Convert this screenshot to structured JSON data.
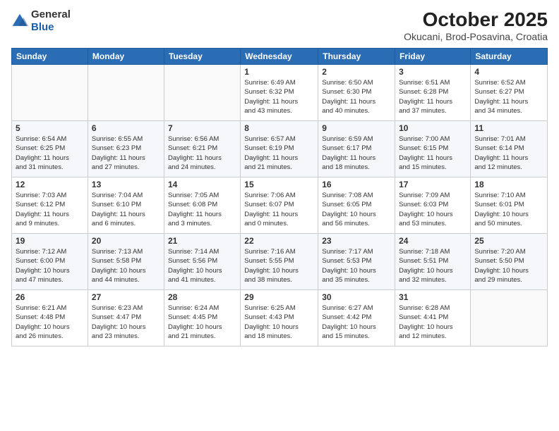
{
  "header": {
    "logo_general": "General",
    "logo_blue": "Blue",
    "title": "October 2025",
    "subtitle": "Okucani, Brod-Posavina, Croatia"
  },
  "weekdays": [
    "Sunday",
    "Monday",
    "Tuesday",
    "Wednesday",
    "Thursday",
    "Friday",
    "Saturday"
  ],
  "weeks": [
    [
      {
        "day": "",
        "info": ""
      },
      {
        "day": "",
        "info": ""
      },
      {
        "day": "",
        "info": ""
      },
      {
        "day": "1",
        "info": "Sunrise: 6:49 AM\nSunset: 6:32 PM\nDaylight: 11 hours\nand 43 minutes."
      },
      {
        "day": "2",
        "info": "Sunrise: 6:50 AM\nSunset: 6:30 PM\nDaylight: 11 hours\nand 40 minutes."
      },
      {
        "day": "3",
        "info": "Sunrise: 6:51 AM\nSunset: 6:28 PM\nDaylight: 11 hours\nand 37 minutes."
      },
      {
        "day": "4",
        "info": "Sunrise: 6:52 AM\nSunset: 6:27 PM\nDaylight: 11 hours\nand 34 minutes."
      }
    ],
    [
      {
        "day": "5",
        "info": "Sunrise: 6:54 AM\nSunset: 6:25 PM\nDaylight: 11 hours\nand 31 minutes."
      },
      {
        "day": "6",
        "info": "Sunrise: 6:55 AM\nSunset: 6:23 PM\nDaylight: 11 hours\nand 27 minutes."
      },
      {
        "day": "7",
        "info": "Sunrise: 6:56 AM\nSunset: 6:21 PM\nDaylight: 11 hours\nand 24 minutes."
      },
      {
        "day": "8",
        "info": "Sunrise: 6:57 AM\nSunset: 6:19 PM\nDaylight: 11 hours\nand 21 minutes."
      },
      {
        "day": "9",
        "info": "Sunrise: 6:59 AM\nSunset: 6:17 PM\nDaylight: 11 hours\nand 18 minutes."
      },
      {
        "day": "10",
        "info": "Sunrise: 7:00 AM\nSunset: 6:15 PM\nDaylight: 11 hours\nand 15 minutes."
      },
      {
        "day": "11",
        "info": "Sunrise: 7:01 AM\nSunset: 6:14 PM\nDaylight: 11 hours\nand 12 minutes."
      }
    ],
    [
      {
        "day": "12",
        "info": "Sunrise: 7:03 AM\nSunset: 6:12 PM\nDaylight: 11 hours\nand 9 minutes."
      },
      {
        "day": "13",
        "info": "Sunrise: 7:04 AM\nSunset: 6:10 PM\nDaylight: 11 hours\nand 6 minutes."
      },
      {
        "day": "14",
        "info": "Sunrise: 7:05 AM\nSunset: 6:08 PM\nDaylight: 11 hours\nand 3 minutes."
      },
      {
        "day": "15",
        "info": "Sunrise: 7:06 AM\nSunset: 6:07 PM\nDaylight: 11 hours\nand 0 minutes."
      },
      {
        "day": "16",
        "info": "Sunrise: 7:08 AM\nSunset: 6:05 PM\nDaylight: 10 hours\nand 56 minutes."
      },
      {
        "day": "17",
        "info": "Sunrise: 7:09 AM\nSunset: 6:03 PM\nDaylight: 10 hours\nand 53 minutes."
      },
      {
        "day": "18",
        "info": "Sunrise: 7:10 AM\nSunset: 6:01 PM\nDaylight: 10 hours\nand 50 minutes."
      }
    ],
    [
      {
        "day": "19",
        "info": "Sunrise: 7:12 AM\nSunset: 6:00 PM\nDaylight: 10 hours\nand 47 minutes."
      },
      {
        "day": "20",
        "info": "Sunrise: 7:13 AM\nSunset: 5:58 PM\nDaylight: 10 hours\nand 44 minutes."
      },
      {
        "day": "21",
        "info": "Sunrise: 7:14 AM\nSunset: 5:56 PM\nDaylight: 10 hours\nand 41 minutes."
      },
      {
        "day": "22",
        "info": "Sunrise: 7:16 AM\nSunset: 5:55 PM\nDaylight: 10 hours\nand 38 minutes."
      },
      {
        "day": "23",
        "info": "Sunrise: 7:17 AM\nSunset: 5:53 PM\nDaylight: 10 hours\nand 35 minutes."
      },
      {
        "day": "24",
        "info": "Sunrise: 7:18 AM\nSunset: 5:51 PM\nDaylight: 10 hours\nand 32 minutes."
      },
      {
        "day": "25",
        "info": "Sunrise: 7:20 AM\nSunset: 5:50 PM\nDaylight: 10 hours\nand 29 minutes."
      }
    ],
    [
      {
        "day": "26",
        "info": "Sunrise: 6:21 AM\nSunset: 4:48 PM\nDaylight: 10 hours\nand 26 minutes."
      },
      {
        "day": "27",
        "info": "Sunrise: 6:23 AM\nSunset: 4:47 PM\nDaylight: 10 hours\nand 23 minutes."
      },
      {
        "day": "28",
        "info": "Sunrise: 6:24 AM\nSunset: 4:45 PM\nDaylight: 10 hours\nand 21 minutes."
      },
      {
        "day": "29",
        "info": "Sunrise: 6:25 AM\nSunset: 4:43 PM\nDaylight: 10 hours\nand 18 minutes."
      },
      {
        "day": "30",
        "info": "Sunrise: 6:27 AM\nSunset: 4:42 PM\nDaylight: 10 hours\nand 15 minutes."
      },
      {
        "day": "31",
        "info": "Sunrise: 6:28 AM\nSunset: 4:41 PM\nDaylight: 10 hours\nand 12 minutes."
      },
      {
        "day": "",
        "info": ""
      }
    ]
  ]
}
